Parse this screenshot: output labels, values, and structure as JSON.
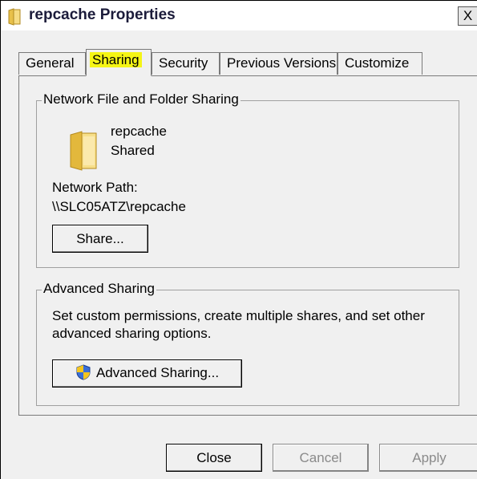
{
  "window": {
    "title": "repcache Properties",
    "close_label": "X"
  },
  "tabs": [
    {
      "label": "General",
      "active": false
    },
    {
      "label": "Sharing",
      "active": true
    },
    {
      "label": "Security",
      "active": false
    },
    {
      "label": "Previous Versions",
      "active": false
    },
    {
      "label": "Customize",
      "active": false
    }
  ],
  "network_sharing": {
    "legend": "Network File and Folder Sharing",
    "folder_name": "repcache",
    "status": "Shared",
    "path_label": "Network Path:",
    "path_value": "\\\\SLC05ATZ\\repcache",
    "share_button": "Share..."
  },
  "advanced_sharing": {
    "legend": "Advanced Sharing",
    "description_line1": "Set custom permissions, create multiple shares, and set other",
    "description_line2": "advanced sharing options.",
    "button": "Advanced Sharing..."
  },
  "footer": {
    "close": "Close",
    "cancel": "Cancel",
    "apply": "Apply"
  },
  "colors": {
    "highlight": "#f5f515",
    "dialog_bg": "#f0f0f0"
  }
}
